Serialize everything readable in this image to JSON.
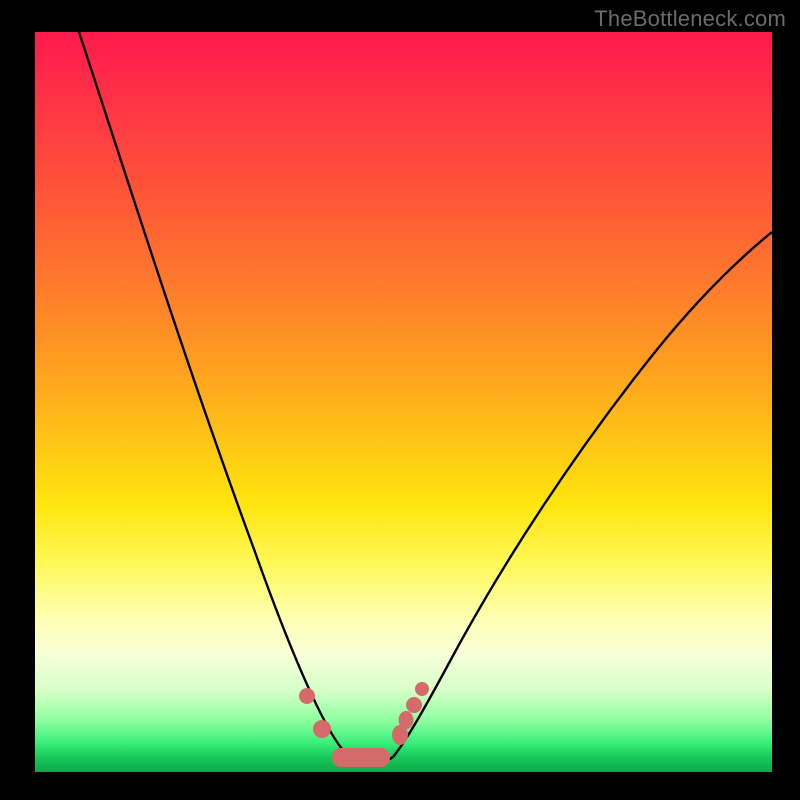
{
  "watermark": "TheBottleneck.com",
  "colors": {
    "curve": "#000000",
    "marker": "#d66a6a",
    "gradient_top": "#ff1a4d",
    "gradient_bottom": "#0aa846",
    "frame": "#000000"
  },
  "chart_data": {
    "type": "line",
    "title": "",
    "xlabel": "",
    "ylabel": "",
    "xlim": [
      0,
      100
    ],
    "ylim": [
      0,
      100
    ],
    "grid": false,
    "legend": false,
    "annotations": [
      "TheBottleneck.com"
    ],
    "series": [
      {
        "name": "curve-left",
        "x": [
          6,
          10,
          14,
          18,
          22,
          26,
          30,
          33,
          35,
          37,
          38.5,
          40
        ],
        "y": [
          100,
          88,
          76,
          64,
          52,
          40,
          28,
          18,
          12,
          8,
          5,
          3
        ]
      },
      {
        "name": "valley-floor",
        "x": [
          40,
          42,
          44,
          46,
          48
        ],
        "y": [
          1.5,
          1,
          1,
          1,
          1.5
        ]
      },
      {
        "name": "curve-right",
        "x": [
          48,
          50,
          53,
          57,
          62,
          68,
          75,
          83,
          92,
          100
        ],
        "y": [
          3,
          6,
          11,
          18,
          27,
          37,
          48,
          58,
          66,
          72
        ]
      }
    ],
    "markers": {
      "name": "highlight-points",
      "shape": "circle",
      "color": "#d66a6a",
      "points": [
        {
          "x": 36.5,
          "y": 9
        },
        {
          "x": 38.7,
          "y": 4
        },
        {
          "x": 40.5,
          "y": 1.6
        },
        {
          "x": 42.5,
          "y": 1.2
        },
        {
          "x": 44.5,
          "y": 1.1
        },
        {
          "x": 46.5,
          "y": 1.2
        },
        {
          "x": 49.2,
          "y": 4.2
        },
        {
          "x": 49.7,
          "y": 5.8
        },
        {
          "x": 50.8,
          "y": 8.0
        },
        {
          "x": 51.8,
          "y": 10.2
        }
      ]
    }
  }
}
